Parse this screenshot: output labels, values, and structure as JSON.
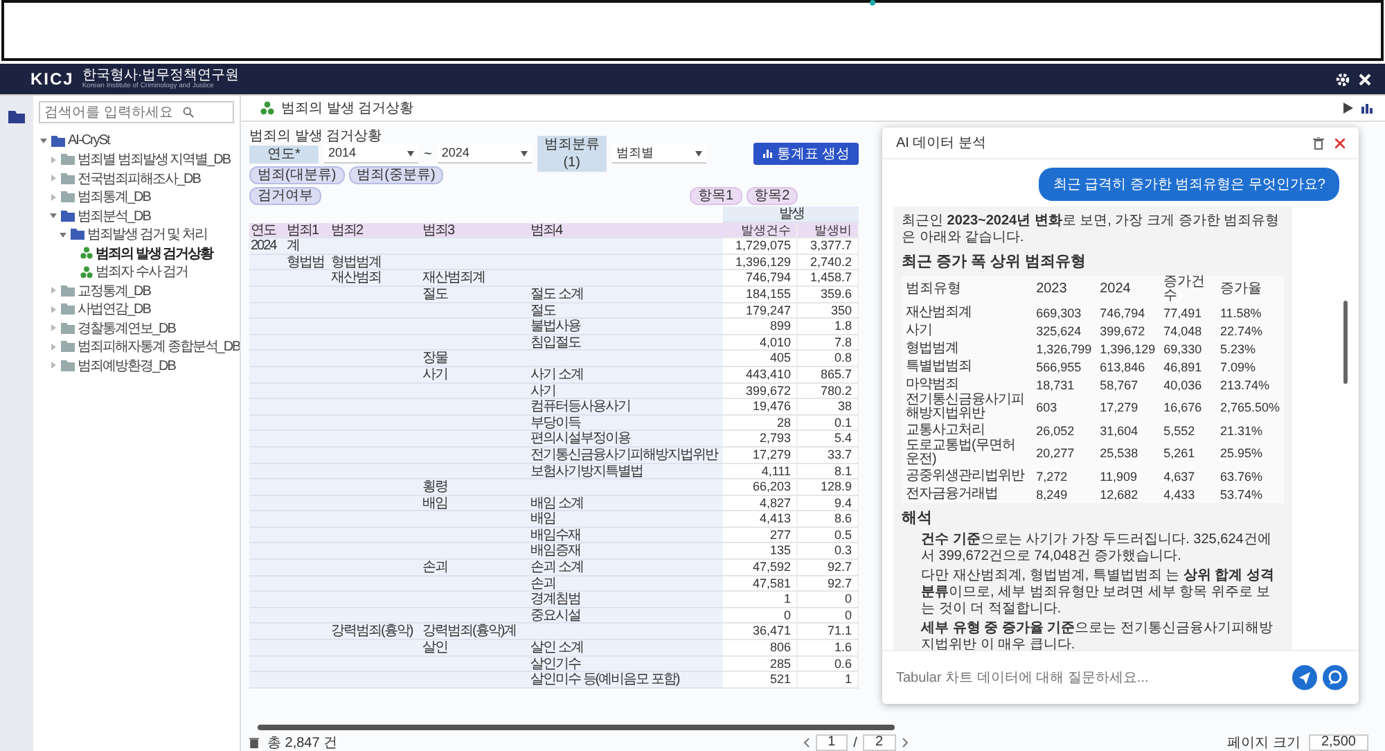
{
  "header": {
    "logo": "KICJ",
    "org": "한국형사·법무정책연구원",
    "org_en": "Korean Institute of Criminology and Justice"
  },
  "sidebar": {
    "search": {
      "placeholder": "검색어를 입력하세요"
    },
    "tree": [
      {
        "label": "AI-CrySt",
        "kind": "folder",
        "expanded": true,
        "selected": false,
        "children": [
          {
            "label": "범죄별 범죄발생 지역별_DB",
            "kind": "folder",
            "expanded": false,
            "selected": false
          },
          {
            "label": "전국범죄피해조사_DB",
            "kind": "folder",
            "expanded": false,
            "selected": false
          },
          {
            "label": "범죄통계_DB",
            "kind": "folder",
            "expanded": false,
            "selected": false
          },
          {
            "label": "범죄분석_DB",
            "kind": "folder",
            "expanded": true,
            "selected": false,
            "children": [
              {
                "label": "범죄발생 검거 및 처리",
                "kind": "folder",
                "expanded": true,
                "selected": false,
                "children": [
                  {
                    "label": "범죄의 발생 검거상황",
                    "kind": "table",
                    "selected": true
                  },
                  {
                    "label": "범죄자 수사 검거",
                    "kind": "table",
                    "selected": false
                  }
                ]
              }
            ]
          },
          {
            "label": "교정통계_DB",
            "kind": "folder",
            "expanded": false,
            "selected": false
          },
          {
            "label": "사법연감_DB",
            "kind": "folder",
            "expanded": false,
            "selected": false
          },
          {
            "label": "경찰통계연보_DB",
            "kind": "folder",
            "expanded": false,
            "selected": false
          },
          {
            "label": "범죄피해자통계 종합분석_DB",
            "kind": "folder",
            "expanded": false,
            "selected": false
          },
          {
            "label": "범죄예방환경_DB",
            "kind": "folder",
            "expanded": false,
            "selected": false
          }
        ]
      }
    ]
  },
  "tab": {
    "title": "범죄의 발생 검거상황"
  },
  "report": {
    "title": "범죄의 발생 검거상황",
    "filters": [
      {
        "kind": "label",
        "text": "연도*"
      },
      {
        "kind": "select",
        "text": "2014"
      },
      {
        "kind": "separator",
        "text": "~"
      },
      {
        "kind": "select",
        "text": "2024"
      },
      {
        "kind": "label",
        "text": "범죄분류(1)"
      },
      {
        "kind": "select",
        "text": "범죄별"
      }
    ],
    "generate_button": "통계표 생성",
    "row_chips": [
      "범죄(대분류)",
      "범죄(중분류)"
    ],
    "row_chips_2": [
      "검거여부"
    ],
    "column_chips": [
      "항목1",
      "항목2"
    ],
    "group_header": "발생",
    "columns": [
      "연도",
      "범죄1",
      "범죄2",
      "범죄3",
      "범죄4",
      "발생건수",
      "발생비"
    ],
    "rows": [
      {
        "year": "2024",
        "c1": "계",
        "count": "1,729,075",
        "ratio": "3,377.7"
      },
      {
        "c1": "형법범",
        "c2": "형법범계",
        "count": "1,396,129",
        "ratio": "2,740.2"
      },
      {
        "c2": "재산범죄",
        "c3": "재산범죄계",
        "count": "746,794",
        "ratio": "1,458.7"
      },
      {
        "c3": "절도",
        "c4": "절도 소계",
        "count": "184,155",
        "ratio": "359.6"
      },
      {
        "c4": "절도",
        "count": "179,247",
        "ratio": "350"
      },
      {
        "c4": "불법사용",
        "count": "899",
        "ratio": "1.8"
      },
      {
        "c4": "침입절도",
        "count": "4,010",
        "ratio": "7.8"
      },
      {
        "c3": "장물",
        "count": "405",
        "ratio": "0.8"
      },
      {
        "c3": "사기",
        "c4": "사기 소계",
        "count": "443,410",
        "ratio": "865.7"
      },
      {
        "c4": "사기",
        "count": "399,672",
        "ratio": "780.2"
      },
      {
        "c4": "컴퓨터등사용사기",
        "count": "19,476",
        "ratio": "38"
      },
      {
        "c4": "부당이득",
        "count": "28",
        "ratio": "0.1"
      },
      {
        "c4": "편의시설부정이용",
        "count": "2,793",
        "ratio": "5.4"
      },
      {
        "c4": "전기통신금융사기피해방지법위반",
        "count": "17,279",
        "ratio": "33.7"
      },
      {
        "c4": "보험사기방지특별법",
        "count": "4,111",
        "ratio": "8.1"
      },
      {
        "c3": "횡령",
        "count": "66,203",
        "ratio": "128.9"
      },
      {
        "c3": "배임",
        "c4": "배임 소계",
        "count": "4,827",
        "ratio": "9.4"
      },
      {
        "c4": "배임",
        "count": "4,413",
        "ratio": "8.6"
      },
      {
        "c4": "배임수재",
        "count": "277",
        "ratio": "0.5"
      },
      {
        "c4": "배임증재",
        "count": "135",
        "ratio": "0.3"
      },
      {
        "c3": "손괴",
        "c4": "손괴 소계",
        "count": "47,592",
        "ratio": "92.7"
      },
      {
        "c4": "손괴",
        "count": "47,581",
        "ratio": "92.7"
      },
      {
        "c4": "경계침범",
        "count": "1",
        "ratio": "0"
      },
      {
        "c4": "중요시설",
        "count": "0",
        "ratio": "0"
      },
      {
        "c2": "강력범죄(흉악)",
        "c3": "강력범죄(흉악)계",
        "count": "36,471",
        "ratio": "71.1"
      },
      {
        "c3": "살인",
        "c4": "살인 소계",
        "count": "806",
        "ratio": "1.6"
      },
      {
        "c4": "살인기수",
        "count": "285",
        "ratio": "0.6"
      },
      {
        "c4": "살인미수 등(예비음모 포함)",
        "count": "521",
        "ratio": "1"
      }
    ],
    "footer": {
      "total": "총 2,847 건",
      "page": "1",
      "page_sep": "/",
      "page_total": "2",
      "page_size_label": "페이지 크기",
      "page_size": "2,500"
    }
  },
  "chat": {
    "title": "AI 데이터 분석",
    "user_message": "최근 급격히 증가한 범죄유형은 무엇인가요?",
    "intro": "최근인 **2023~2024년 변화**로 보면, 가장 크게 증가한 범죄유형은 아래와 같습니다.",
    "table_title": "최근 증가 폭 상위 범죄유형",
    "table_columns": [
      "범죄유형",
      "2023",
      "2024",
      "증가건수",
      "증가율"
    ],
    "table_rows": [
      [
        "재산범죄계",
        "669,303",
        "746,794",
        "77,491",
        "11.58%"
      ],
      [
        "사기",
        "325,624",
        "399,672",
        "74,048",
        "22.74%"
      ],
      [
        "형법범계",
        "1,326,799",
        "1,396,129",
        "69,330",
        "5.23%"
      ],
      [
        "특별법범죄",
        "566,955",
        "613,846",
        "46,891",
        "7.09%"
      ],
      [
        "마약범죄",
        "18,731",
        "58,767",
        "40,036",
        "213.74%"
      ],
      [
        "전기통신금융사기피해방지법위반",
        "603",
        "17,279",
        "16,676",
        "2,765.50%"
      ],
      [
        "교통사고처리",
        "26,052",
        "31,604",
        "5,552",
        "21.31%"
      ],
      [
        "도로교통법(무면허운전)",
        "20,277",
        "25,538",
        "5,261",
        "25.95%"
      ],
      [
        "공중위생관리법위반",
        "7,272",
        "11,909",
        "4,637",
        "63.76%"
      ],
      [
        "전자금융거래법",
        "8,249",
        "12,682",
        "4,433",
        "53.74%"
      ]
    ],
    "analysis_title": "해석",
    "analysis": [
      "**건수 기준**으로는 사기가 가장 두드러집니다. 325,624건에서 399,672건으로 74,048건 증가했습니다.",
      "다만 재산범죄계, 형법범계, 특별법범죄 는 **상위 합계 성격 분류**이므로, 세부 범죄유형만 보려면 세부 항목 위주로 보는 것이 더 적절합니다.",
      "**세부 유형 중 증가율 기준**으로는 전기통신금융사기피해방지법위반 이 매우 큽니다."
    ],
    "input": {
      "placeholder": "Tabular 차트 데이터에 대해 질문하세요..."
    }
  }
}
